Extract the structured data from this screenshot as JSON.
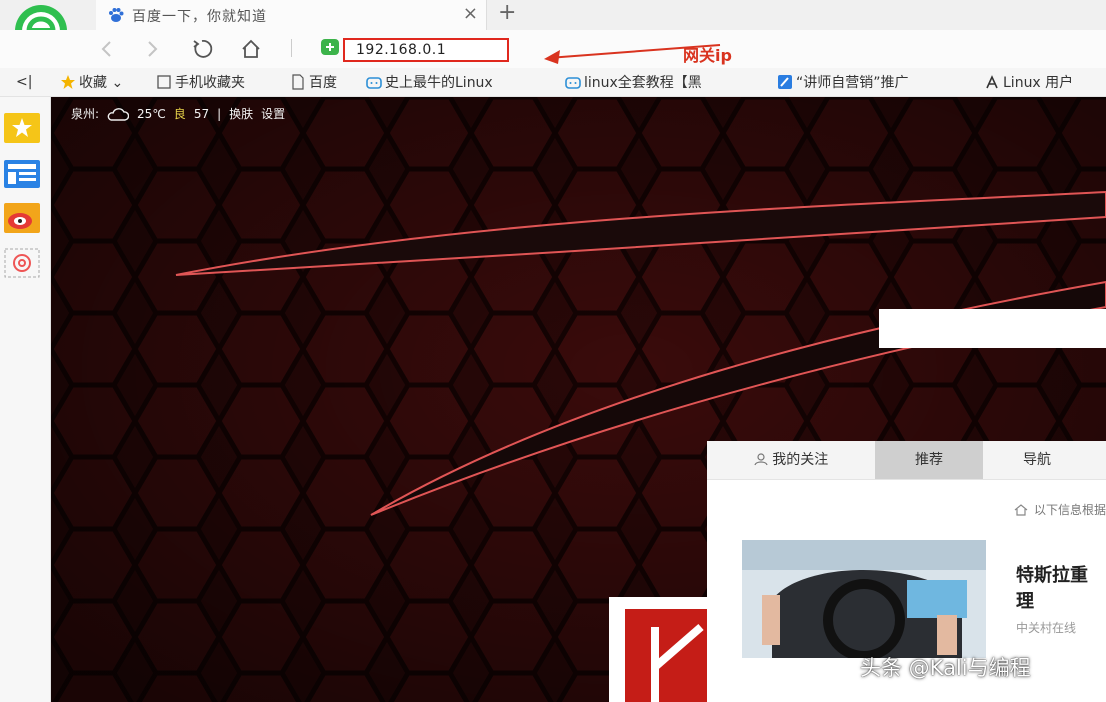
{
  "browser": {
    "tab": {
      "title": "百度一下，你就知道",
      "close": "×"
    },
    "new_tab": "+",
    "address": "192.168.0.1",
    "annotation": "网关ip"
  },
  "bookmarks": [
    {
      "label": "<|",
      "icon": "collapse-icon"
    },
    {
      "label": "收藏 ⌄",
      "icon": "star-icon"
    },
    {
      "label": "手机收藏夹",
      "icon": "phone-icon"
    },
    {
      "label": "百度",
      "icon": "page-icon"
    },
    {
      "label": "史上最牛的Linux",
      "icon": "bilibili-icon"
    },
    {
      "label": "linux全套教程【黑",
      "icon": "bilibili-icon"
    },
    {
      "label": "“讲师自营销”推广",
      "icon": "edit-icon"
    },
    {
      "label": "Linux 用户",
      "icon": "linux-icon"
    }
  ],
  "weather": {
    "city": "泉州:",
    "temp": "25℃",
    "aqi_label": "良",
    "aqi": "57",
    "sep": "|",
    "skin": "换肤",
    "settings": "设置"
  },
  "feed": {
    "tabs": [
      "我的关注",
      "推荐",
      "导航"
    ],
    "active_tab": 1,
    "notice": "以下信息根据",
    "article": {
      "title": "特斯拉重理",
      "title_line1": "特斯拉重",
      "title_line2": "理",
      "source": "中关村在线"
    }
  },
  "watermark": "头条 @Kali与编程",
  "colors": {
    "annotation_red": "#d9331f",
    "page_bg": "#2a0808",
    "accent_green": "#3cb34a"
  }
}
